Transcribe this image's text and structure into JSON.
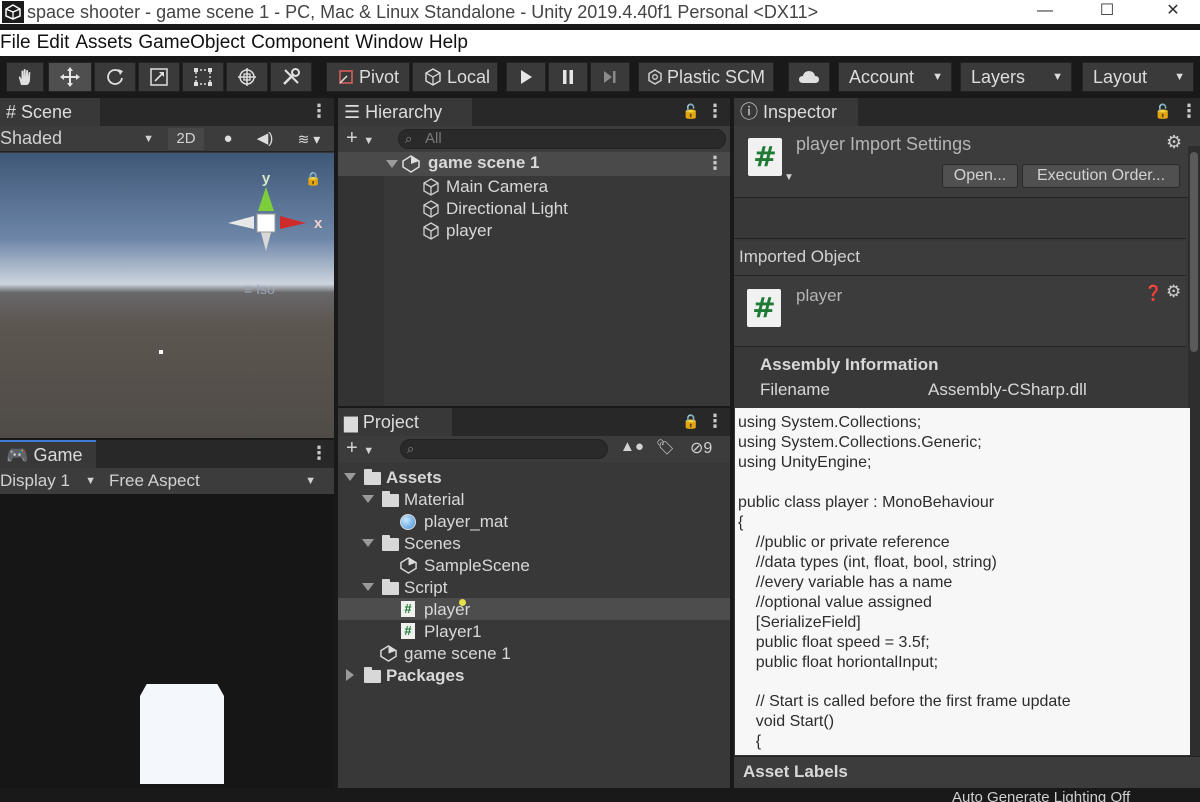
{
  "window": {
    "title": "space shooter - game scene 1 - PC, Mac & Linux Standalone - Unity 2019.4.40f1 Personal <DX11>",
    "minimize": "—",
    "maximize": "☐",
    "close": "✕"
  },
  "menu": [
    "File",
    "Edit",
    "Assets",
    "GameObject",
    "Component",
    "Window",
    "Help"
  ],
  "toolbar": {
    "pivot": "Pivot",
    "local": "Local",
    "plastic": "Plastic SCM",
    "account": "Account",
    "layers": "Layers",
    "layout": "Layout",
    "tools": [
      "hand-tool-icon",
      "move-tool-icon",
      "rotate-tool-icon",
      "scale-tool-icon",
      "rect-tool-icon",
      "transform-tool-icon",
      "custom-tool-icon"
    ]
  },
  "scene": {
    "tab": "Scene",
    "shading": "Shaded",
    "mode2d": "2D",
    "gizmo_y": "y",
    "gizmo_x": "x",
    "iso": "Iso"
  },
  "game": {
    "tab": "Game",
    "display": "Display 1",
    "aspect": "Free Aspect"
  },
  "hierarchy": {
    "tab": "Hierarchy",
    "search_placeholder": "All",
    "root": "game scene 1",
    "items": [
      "Main Camera",
      "Directional Light",
      "player"
    ]
  },
  "project": {
    "tab": "Project",
    "hidden_count": "9",
    "tree": {
      "assets": "Assets",
      "material": "Material",
      "player_mat": "player_mat",
      "scenes": "Scenes",
      "sample_scene": "SampleScene",
      "script": "Script",
      "player": "player",
      "player1": "Player1",
      "game_scene": "game scene 1",
      "packages": "Packages"
    }
  },
  "inspector": {
    "tab": "Inspector",
    "header_title": "player Import Settings",
    "open_button": "Open...",
    "execution_order_button": "Execution Order...",
    "imported_object": "Imported Object",
    "object_name": "player",
    "assembly_info": "Assembly Information",
    "filename_label": "Filename",
    "filename_value": "Assembly-CSharp.dll",
    "asset_labels": "Asset Labels",
    "code": [
      "using System.Collections;",
      "using System.Collections.Generic;",
      "using UnityEngine;",
      "",
      "public class player : MonoBehaviour",
      "{",
      "    //public or private reference",
      "    //data types (int, float, bool, string)",
      "    //every variable has a name",
      "    //optional value assigned",
      "    [SerializeField]",
      "    public float speed = 3.5f;",
      "    public float horiontalInput;",
      "",
      "    // Start is called before the first frame update",
      "    void Start()",
      "    {"
    ]
  },
  "statusbar": {
    "text": "Auto Generate Lighting Off"
  }
}
